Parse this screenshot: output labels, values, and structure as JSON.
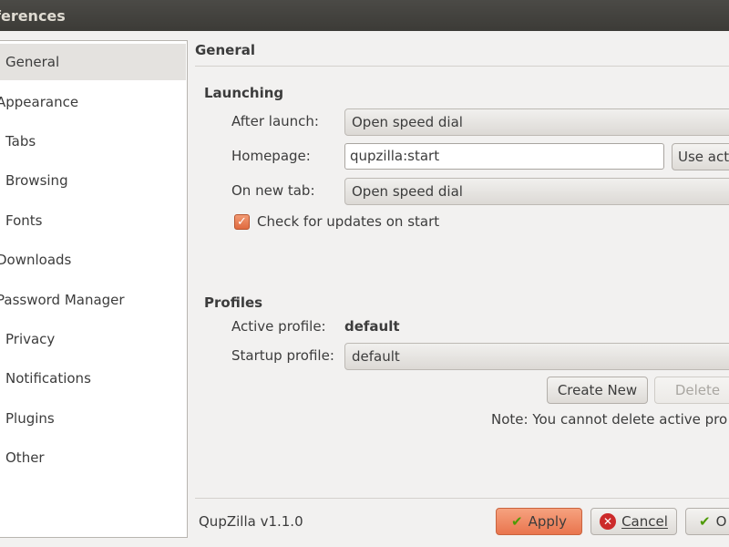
{
  "window": {
    "title": "ferences"
  },
  "sidebar": {
    "items": [
      {
        "label": "General"
      },
      {
        "label": "Appearance"
      },
      {
        "label": "Tabs"
      },
      {
        "label": "Browsing"
      },
      {
        "label": "Fonts"
      },
      {
        "label": "Downloads"
      },
      {
        "label": "Password Manager"
      },
      {
        "label": "Privacy"
      },
      {
        "label": "Notifications"
      },
      {
        "label": "Plugins"
      },
      {
        "label": "Other"
      }
    ]
  },
  "main": {
    "title": "General",
    "launching": {
      "title": "Launching",
      "after_launch_label": "After launch:",
      "after_launch_value": "Open speed dial",
      "homepage_label": "Homepage:",
      "homepage_value": "qupzilla:start",
      "use_current_label": "Use acti",
      "new_tab_label": "On new tab:",
      "new_tab_value": "Open speed dial",
      "check_updates_label": "Check for updates on start"
    },
    "profiles": {
      "title": "Profiles",
      "active_profile_label": "Active profile:",
      "active_profile_value": "default",
      "startup_profile_label": "Startup profile:",
      "startup_profile_value": "default",
      "create_new_label": "Create New",
      "delete_label": "Delete",
      "note": "Note: You cannot delete active pro"
    }
  },
  "footer": {
    "version": "QupZilla v1.1.0",
    "apply_label": "Apply",
    "cancel_label": "Cancel",
    "ok_label": "O"
  },
  "colors": {
    "accent": "#e9754e",
    "titlebar": "#3c3b37",
    "selection": "#e4e2df"
  }
}
